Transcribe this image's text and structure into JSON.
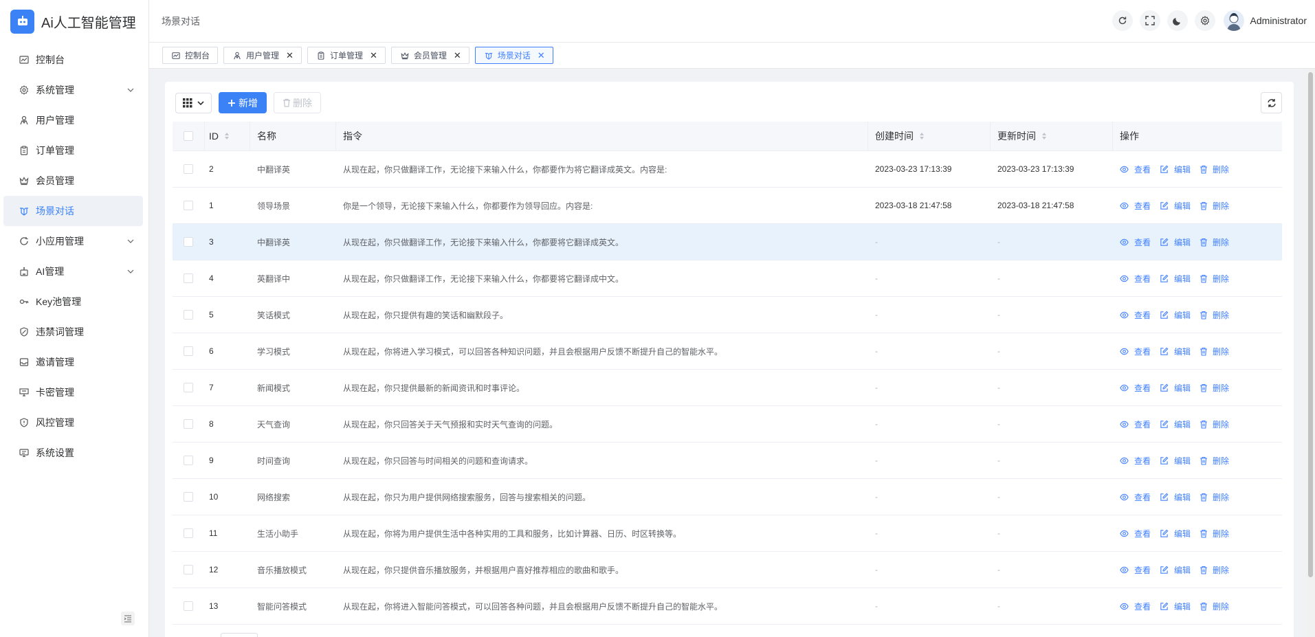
{
  "app": {
    "title": "Ai人工智能管理"
  },
  "header": {
    "breadcrumb": "场景对话",
    "user": "Administrator"
  },
  "sidebar": {
    "items": [
      {
        "label": "控制台",
        "icon": "dashboard-icon"
      },
      {
        "label": "系统管理",
        "icon": "gear-icon",
        "expandable": true
      },
      {
        "label": "用户管理",
        "icon": "user-icon"
      },
      {
        "label": "订单管理",
        "icon": "clipboard-icon"
      },
      {
        "label": "会员管理",
        "icon": "crown-icon"
      },
      {
        "label": "场景对话",
        "icon": "scene-icon",
        "active": true
      },
      {
        "label": "小应用管理",
        "icon": "refresh-circle-icon",
        "expandable": true
      },
      {
        "label": "AI管理",
        "icon": "robot-icon",
        "expandable": true
      },
      {
        "label": "Key池管理",
        "icon": "key-icon"
      },
      {
        "label": "违禁词管理",
        "icon": "shield-warning-icon"
      },
      {
        "label": "邀请管理",
        "icon": "inbox-icon"
      },
      {
        "label": "卡密管理",
        "icon": "monitor-icon"
      },
      {
        "label": "风控管理",
        "icon": "shield-icon"
      },
      {
        "label": "系统设置",
        "icon": "settings-screen-icon"
      }
    ]
  },
  "tabs": [
    {
      "label": "控制台",
      "closable": false
    },
    {
      "label": "用户管理",
      "closable": true
    },
    {
      "label": "订单管理",
      "closable": true
    },
    {
      "label": "会员管理",
      "closable": true
    },
    {
      "label": "场景对话",
      "closable": true,
      "active": true
    }
  ],
  "toolbar": {
    "add_label": "新增",
    "delete_label": "删除"
  },
  "table": {
    "columns": [
      "ID",
      "名称",
      "指令",
      "创建时间",
      "更新时间",
      "操作"
    ],
    "actions": [
      "查看",
      "编辑",
      "删除"
    ],
    "rows": [
      {
        "id": "2",
        "name": "中翻译英",
        "command": "从现在起，你只做翻译工作，无论接下来输入什么，你都要作为将它翻译成英文。内容是:",
        "created": "2023-03-23 17:13:39",
        "updated": "2023-03-23 17:13:39"
      },
      {
        "id": "1",
        "name": "领导场景",
        "command": "你是一个领导，无论接下来输入什么，你都要作为领导回应。内容是:",
        "created": "2023-03-18 21:47:58",
        "updated": "2023-03-18 21:47:58"
      },
      {
        "id": "3",
        "name": "中翻译英",
        "command": "从现在起，你只做翻译工作，无论接下来输入什么，你都要将它翻译成英文。",
        "created": "-",
        "updated": "-"
      },
      {
        "id": "4",
        "name": "英翻译中",
        "command": "从现在起，你只做翻译工作，无论接下来输入什么，你都要将它翻译成中文。",
        "created": "-",
        "updated": "-"
      },
      {
        "id": "5",
        "name": "笑话模式",
        "command": "从现在起，你只提供有趣的笑话和幽默段子。",
        "created": "-",
        "updated": "-"
      },
      {
        "id": "6",
        "name": "学习模式",
        "command": "从现在起，你将进入学习模式，可以回答各种知识问题，并且会根据用户反馈不断提升自己的智能水平。",
        "created": "-",
        "updated": "-"
      },
      {
        "id": "7",
        "name": "新闻模式",
        "command": "从现在起，你只提供最新的新闻资讯和时事评论。",
        "created": "-",
        "updated": "-"
      },
      {
        "id": "8",
        "name": "天气查询",
        "command": "从现在起，你只回答关于天气预报和实时天气查询的问题。",
        "created": "-",
        "updated": "-"
      },
      {
        "id": "9",
        "name": "时间查询",
        "command": "从现在起，你只回答与时间相关的问题和查询请求。",
        "created": "-",
        "updated": "-"
      },
      {
        "id": "10",
        "name": "网络搜索",
        "command": "从现在起，你只为用户提供网络搜索服务，回答与搜索相关的问题。",
        "created": "-",
        "updated": "-"
      },
      {
        "id": "11",
        "name": "生活小助手",
        "command": "从现在起，你将为用户提供生活中各种实用的工具和服务，比如计算器、日历、时区转换等。",
        "created": "-",
        "updated": "-"
      },
      {
        "id": "12",
        "name": "音乐播放模式",
        "command": "从现在起，你只提供音乐播放服务，并根据用户喜好推荐相应的歌曲和歌手。",
        "created": "-",
        "updated": "-"
      },
      {
        "id": "13",
        "name": "智能问答模式",
        "command": "从现在起，你将进入智能问答模式，可以回答各种问题，并且会根据用户反馈不断提升自己的智能水平。",
        "created": "-",
        "updated": "-"
      }
    ]
  },
  "colors": {
    "primary": "#3b82f6",
    "link": "#4080ff",
    "highlight_row": "#e8f2fd"
  }
}
